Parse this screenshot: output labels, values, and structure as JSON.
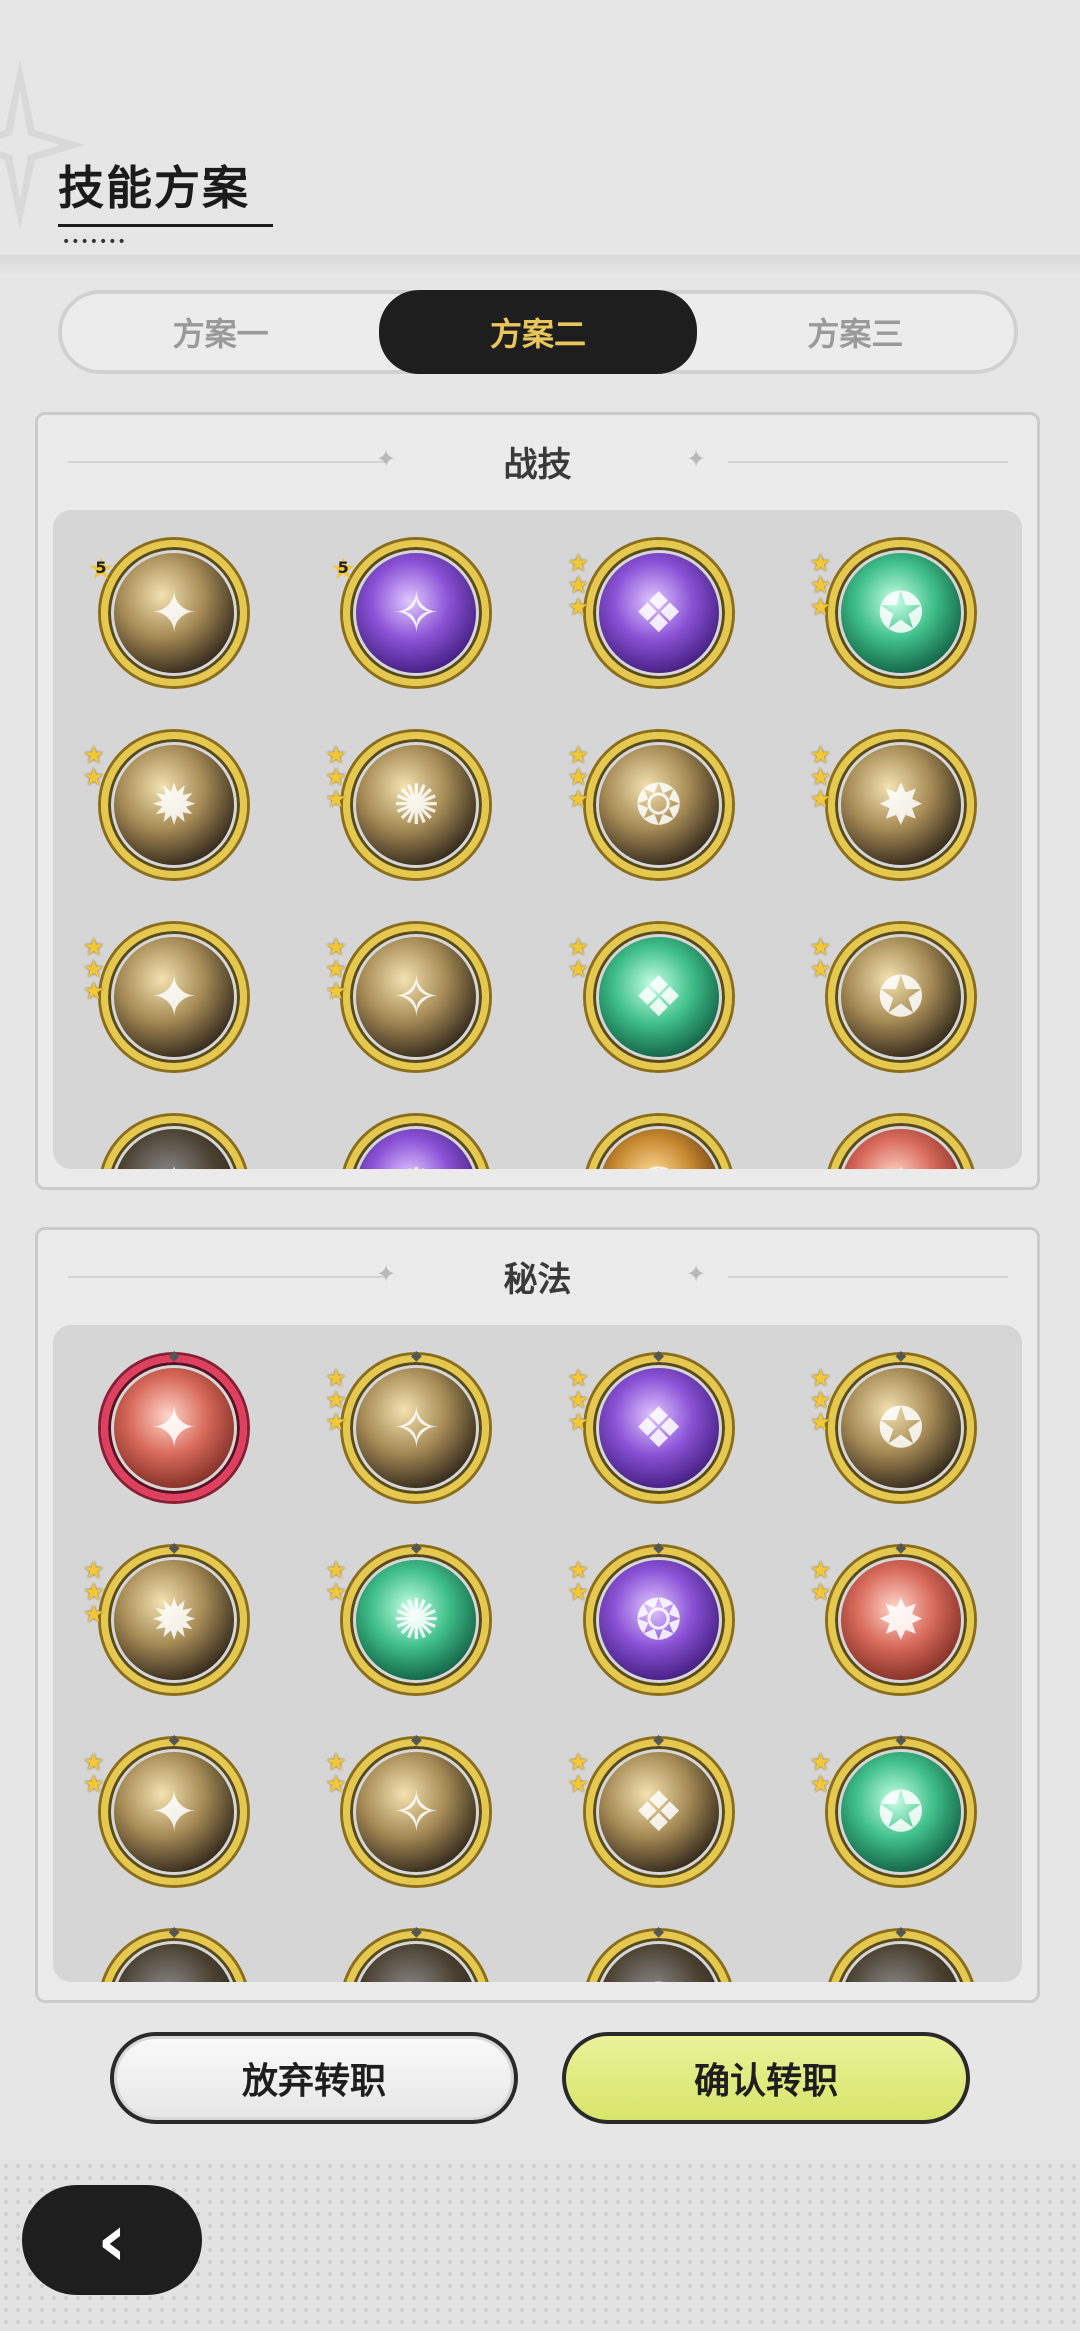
{
  "header": {
    "title": "技能方案",
    "dots": "•••••••"
  },
  "tabs": [
    {
      "label": "方案一",
      "active": false
    },
    {
      "label": "方案二",
      "active": true
    },
    {
      "label": "方案三",
      "active": false
    }
  ],
  "combat": {
    "title": "战技",
    "icons": [
      {
        "name": "golden-slash-icon",
        "stars": "5",
        "palette": "gold"
      },
      {
        "name": "purple-claw-icon",
        "stars": "5",
        "palette": "purple"
      },
      {
        "name": "purple-heart-burst-icon",
        "stars": 3,
        "palette": "purple"
      },
      {
        "name": "green-arrows-icon",
        "stars": 3,
        "palette": "green"
      },
      {
        "name": "spin-slash-icon",
        "stars": 2,
        "palette": "gold"
      },
      {
        "name": "sweeping-slash-icon",
        "stars": 3,
        "palette": "gold"
      },
      {
        "name": "ground-spikes-icon",
        "stars": 3,
        "palette": "gold"
      },
      {
        "name": "diagonal-strike-icon",
        "stars": 3,
        "palette": "gold"
      },
      {
        "name": "afterimage-dash-icon",
        "stars": 3,
        "palette": "gold"
      },
      {
        "name": "reaching-hand-icon",
        "stars": 3,
        "palette": "gold"
      },
      {
        "name": "green-sword-icon",
        "stars": 2,
        "palette": "green"
      },
      {
        "name": "shining-shield-icon",
        "stars": 2,
        "palette": "gold"
      },
      {
        "name": "partial-dark-icon",
        "stars": 0,
        "palette": "dark"
      },
      {
        "name": "partial-purple-icon",
        "stars": 0,
        "palette": "purple"
      },
      {
        "name": "partial-orange-icon",
        "stars": 0,
        "palette": "orange"
      },
      {
        "name": "partial-red-icon",
        "stars": 0,
        "palette": "red"
      }
    ]
  },
  "arcane": {
    "title": "秘法",
    "icons": [
      {
        "name": "red-fist-icon",
        "stars": 0,
        "palette": "red",
        "frame": "red"
      },
      {
        "name": "golden-crowd-icon",
        "stars": 3,
        "palette": "gold"
      },
      {
        "name": "purple-figure-icon",
        "stars": 3,
        "palette": "purple"
      },
      {
        "name": "heart-shield-icon",
        "stars": 3,
        "palette": "gold"
      },
      {
        "name": "golden-target-icon",
        "stars": 3,
        "palette": "gold"
      },
      {
        "name": "green-heal-icon",
        "stars": 2,
        "palette": "green"
      },
      {
        "name": "purple-orb-icon",
        "stars": 2,
        "palette": "purple"
      },
      {
        "name": "red-sword-plus-icon",
        "stars": 2,
        "palette": "red"
      },
      {
        "name": "golden-beast-icon",
        "stars": 2,
        "palette": "gold"
      },
      {
        "name": "silver-sword-icon",
        "stars": 2,
        "palette": "gold"
      },
      {
        "name": "golden-armor-icon",
        "stars": 2,
        "palette": "gold"
      },
      {
        "name": "green-heart-icon",
        "stars": 2,
        "palette": "green"
      },
      {
        "name": "partial-icon-1",
        "stars": 0,
        "palette": "dark"
      },
      {
        "name": "partial-icon-2",
        "stars": 0,
        "palette": "dark"
      },
      {
        "name": "partial-icon-3",
        "stars": 0,
        "palette": "dark"
      },
      {
        "name": "partial-icon-4",
        "stars": 0,
        "palette": "dark"
      }
    ]
  },
  "buttons": {
    "abandon": "放弃转职",
    "confirm": "确认转职"
  },
  "back": {
    "glyph": "‹"
  },
  "colors": {
    "accent": "#e9c65a",
    "confirm_bg": "#dbe66f",
    "dark": "#1e1e1e"
  }
}
